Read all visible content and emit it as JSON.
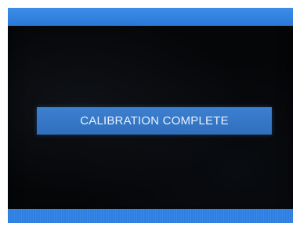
{
  "status": {
    "message": "CALIBRATION COMPLETE"
  },
  "colors": {
    "screen_background": "#050608",
    "bar_blue": "#2a78d8",
    "banner_blue": "#3577c6",
    "banner_text": "#e8f0fb"
  }
}
